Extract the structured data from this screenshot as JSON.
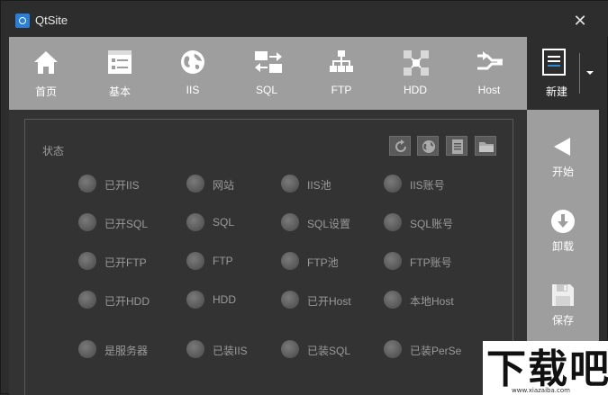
{
  "window": {
    "title": "QtSite",
    "close_icon": "close-icon"
  },
  "toolbar": {
    "items": [
      {
        "label": "首页",
        "icon": "home-icon"
      },
      {
        "label": "基本",
        "icon": "form-icon"
      },
      {
        "label": "IIS",
        "icon": "globe-icon"
      },
      {
        "label": "SQL",
        "icon": "database-transfer-icon"
      },
      {
        "label": "FTP",
        "icon": "network-icon"
      },
      {
        "label": "HDD",
        "icon": "share-icon"
      },
      {
        "label": "Host",
        "icon": "connect-icon"
      }
    ],
    "new_button": {
      "label": "新建",
      "icon": "document-icon"
    }
  },
  "status_panel": {
    "title": "状态",
    "tools": [
      "refresh-icon",
      "globe-icon",
      "document-icon",
      "folder-icon"
    ],
    "rows": [
      [
        "已开IIS",
        "网站",
        "IIS池",
        "IIS账号"
      ],
      [
        "已开SQL",
        "SQL",
        "SQL设置",
        "SQL账号"
      ],
      [
        "已开FTP",
        "FTP",
        "FTP池",
        "FTP账号"
      ],
      [
        "已开HDD",
        "HDD",
        "已开Host",
        "本地Host"
      ],
      [
        "是服务器",
        "已装IIS",
        "已装SQL",
        "已装PerSe"
      ]
    ]
  },
  "sidebar": {
    "items": [
      {
        "label": "开始",
        "icon": "play-icon"
      },
      {
        "label": "卸载",
        "icon": "download-icon"
      },
      {
        "label": "保存",
        "icon": "save-icon"
      }
    ]
  },
  "watermark": {
    "text": "下载吧",
    "url_text": "www.xiazaiba.com"
  },
  "colors": {
    "toolbar_bg": "#9e9e9e",
    "window_bg": "#2d2d2d",
    "panel_bg": "#333333",
    "indicator": "#5f5f5f"
  }
}
